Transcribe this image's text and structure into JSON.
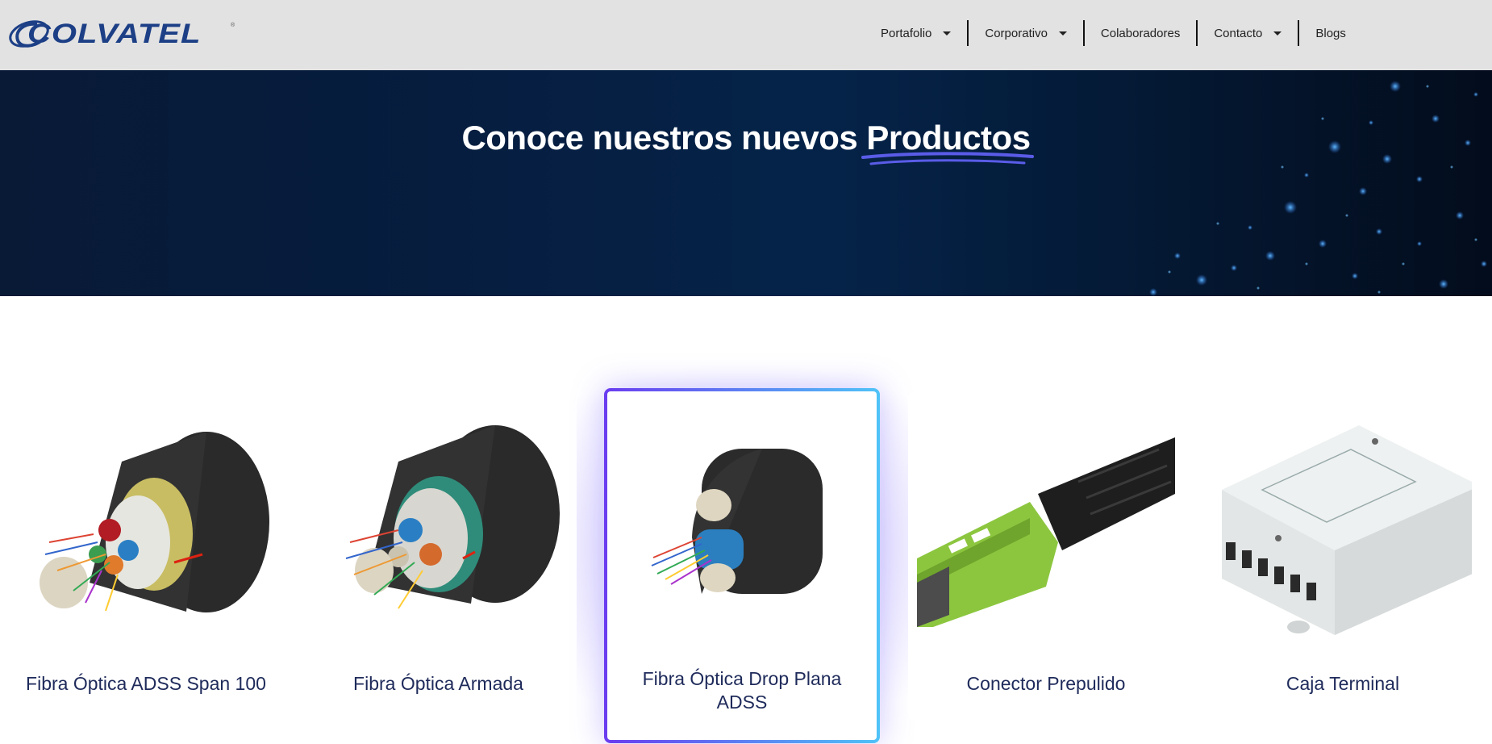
{
  "brand": {
    "logo_text": "COLVATEL",
    "reg_mark": "®",
    "color": "#1c3f86"
  },
  "nav": {
    "items": [
      {
        "label": "Portafolio",
        "has_dropdown": true
      },
      {
        "label": "Corporativo",
        "has_dropdown": true
      },
      {
        "label": "Colaboradores",
        "has_dropdown": false
      },
      {
        "label": "Contacto",
        "has_dropdown": true
      },
      {
        "label": "Blogs",
        "has_dropdown": false
      }
    ]
  },
  "hero": {
    "title_prefix": "Conoce nuestros nuevos",
    "title_highlight": "Productos",
    "underline_color": "#5a5ce8"
  },
  "products": [
    {
      "title": "Fibra Óptica ADSS Span 100",
      "icon": "fiber-cable-adss-image",
      "active": false
    },
    {
      "title": "Fibra Óptica Armada",
      "icon": "fiber-cable-armored-image",
      "active": false
    },
    {
      "title": "Fibra Óptica Drop Plana ADSS",
      "icon": "fiber-drop-flat-image",
      "active": true
    },
    {
      "title": "Conector Prepulido",
      "icon": "prepolished-connector-image",
      "active": false
    },
    {
      "title": "Caja Terminal",
      "icon": "terminal-box-image",
      "active": false
    }
  ],
  "colors": {
    "accent_start": "#6a3cf0",
    "accent_end": "#4fc3f7",
    "card_title": "#1e2a5a",
    "header_bg": "#e2e2e2"
  }
}
